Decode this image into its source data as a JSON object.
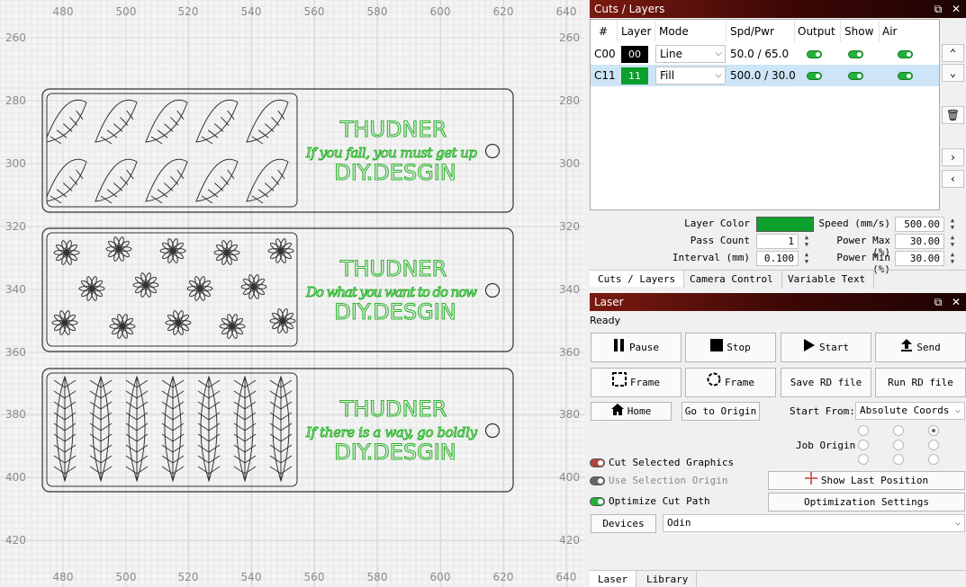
{
  "canvas": {
    "ruler_top": [
      "480",
      "500",
      "520",
      "540",
      "560",
      "580",
      "600",
      "620",
      "640"
    ],
    "ruler_side": [
      "260",
      "280",
      "300",
      "320",
      "340",
      "360",
      "380",
      "400",
      "420"
    ],
    "ruler_bottom": [
      "480",
      "500",
      "520",
      "540",
      "560",
      "580",
      "600",
      "620",
      "640"
    ],
    "tags": [
      {
        "brand": "THUDNER",
        "slogan": "If you fall, you must get up",
        "site": "DIY.DESGIN",
        "pattern": "leaves"
      },
      {
        "brand": "THUDNER",
        "slogan": "Do what you want to do now",
        "site": "DIY.DESGIN",
        "pattern": "flowers"
      },
      {
        "brand": "THUDNER",
        "slogan": "If there is a way, go boldly",
        "site": "DIY.DESGIN",
        "pattern": "feathers"
      }
    ],
    "text_color": "#2fb52f"
  },
  "cuts_panel": {
    "title": "Cuts / Layers",
    "columns": [
      "#",
      "Layer",
      "Mode",
      "Spd/Pwr",
      "Output",
      "Show",
      "Air"
    ],
    "rows": [
      {
        "id": "C00",
        "layer": "00",
        "layer_color": "#000000",
        "mode": "Line",
        "spd_pwr": "50.0 / 65.0",
        "output": true,
        "show": true,
        "air": true,
        "selected": false
      },
      {
        "id": "C11",
        "layer": "11",
        "layer_color": "#0c9f2c",
        "mode": "Fill",
        "spd_pwr": "500.0 / 30.0",
        "output": true,
        "show": true,
        "air": true,
        "selected": true
      }
    ],
    "fields": {
      "layer_color_label": "Layer Color",
      "layer_color_value": "#0c9f2c",
      "pass_count_label": "Pass Count",
      "pass_count": "1",
      "interval_label": "Interval (mm)",
      "interval": "0.100",
      "speed_label": "Speed (mm/s)",
      "speed": "500.00",
      "power_max_label": "Power Max (%)",
      "power_max": "30.00",
      "power_min_label": "Power Min (%)",
      "power_min": "30.00"
    },
    "tabs": [
      "Cuts / Layers",
      "Camera Control",
      "Variable Text"
    ]
  },
  "laser_panel": {
    "title": "Laser",
    "status": "Ready",
    "buttons": {
      "pause": "Pause",
      "stop": "Stop",
      "start": "Start",
      "send": "Send",
      "frame_rect": "Frame",
      "frame_circle": "Frame",
      "save_rd": "Save RD file",
      "run_rd": "Run RD file",
      "home": "Home",
      "go_to_origin": "Go to Origin",
      "show_last_position": "Show Last Position",
      "optimization_settings": "Optimization Settings",
      "devices": "Devices"
    },
    "start_from_label": "Start From:",
    "start_from_value": "Absolute Coords",
    "job_origin_label": "Job Origin",
    "options": {
      "cut_selected": "Cut Selected Graphics",
      "use_selection_origin": "Use Selection Origin",
      "optimize_cut_path": "Optimize Cut Path"
    },
    "device_value": "Odin",
    "tabs": [
      "Laser",
      "Library"
    ]
  }
}
